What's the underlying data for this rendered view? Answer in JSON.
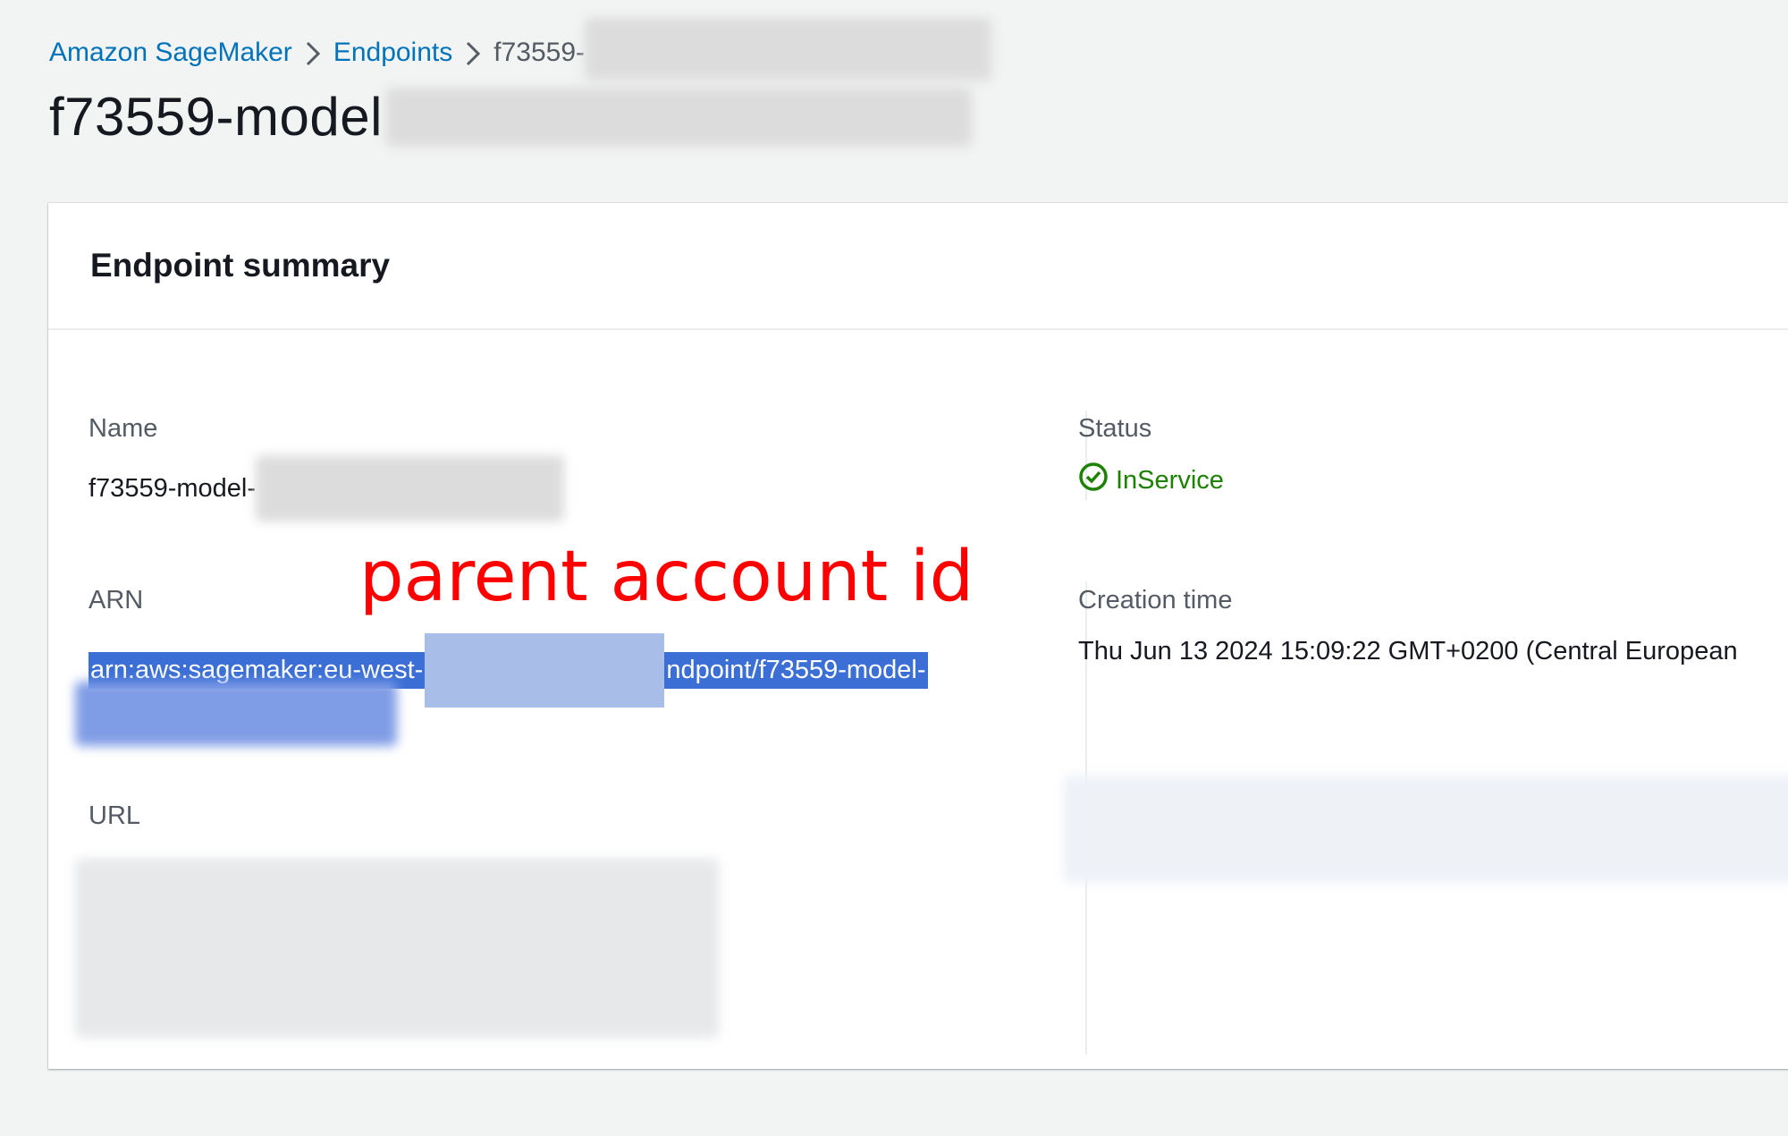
{
  "breadcrumb": {
    "items": [
      "Amazon SageMaker",
      "Endpoints"
    ],
    "current": "f73559-"
  },
  "page": {
    "title": "f73559-model"
  },
  "summary": {
    "heading": "Endpoint summary",
    "name_label": "Name",
    "name_value": "f73559-model-",
    "status_label": "Status",
    "status_value": "InService",
    "arn_label": "ARN",
    "arn_value_start": "arn:aws:sagemaker:eu-west-",
    "arn_value_end": "ndpoint/f73559-model-",
    "creation_label": "Creation time",
    "creation_value": "Thu Jun 13 2024 15:09:22 GMT+0200 (Central European",
    "url_label": "URL"
  },
  "annotation": {
    "text": "parent account id"
  },
  "colors": {
    "link": "#0073bb",
    "success": "#1d8102",
    "selection": "#3b6fd6",
    "annotation": "#ff0000"
  },
  "icons": {
    "breadcrumb_separator": "chevron-right-icon",
    "status": "check-circle-icon"
  }
}
